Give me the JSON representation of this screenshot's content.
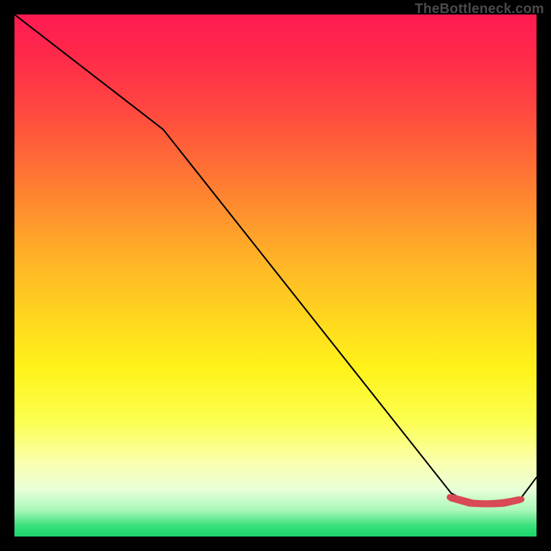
{
  "watermark": "TheBottleneck.com",
  "colors": {
    "gradient_top": "#ff1a52",
    "gradient_mid1": "#ff7a32",
    "gradient_mid2": "#ffd61e",
    "gradient_mid3": "#fcff52",
    "gradient_bottom": "#1bd66a",
    "curve": "#000000",
    "marker": "#d84a55",
    "background": "#000000",
    "watermark_text": "#4a4a4a"
  },
  "chart_data": {
    "type": "line",
    "title": "",
    "xlabel": "",
    "ylabel": "",
    "xlim": [
      0,
      100
    ],
    "ylim": [
      0,
      100
    ],
    "note": "Axes are unlabeled; x/y are normalized 0–100. y=100 at top (red), y=0 at bottom (green). Curve descends from top-left to a trough near x≈88 then rises.",
    "series": [
      {
        "name": "curve",
        "x": [
          0,
          28.5,
          83.6,
          87.1,
          93.9,
          96.8,
          100
        ],
        "y": [
          100,
          78.0,
          8.3,
          6.5,
          6.3,
          7.1,
          11.3
        ]
      }
    ],
    "markers": {
      "name": "optimal-region",
      "x_range": [
        83.1,
        97.1
      ],
      "y_approx": 7.0,
      "color": "#d84a55"
    },
    "background_gradient": {
      "direction": "top-to-bottom",
      "stops": [
        {
          "pos": 0.0,
          "color": "#ff1a52"
        },
        {
          "pos": 0.32,
          "color": "#ff7a32"
        },
        {
          "pos": 0.58,
          "color": "#ffd61e"
        },
        {
          "pos": 0.78,
          "color": "#fcff52"
        },
        {
          "pos": 1.0,
          "color": "#1bd66a"
        }
      ]
    }
  }
}
